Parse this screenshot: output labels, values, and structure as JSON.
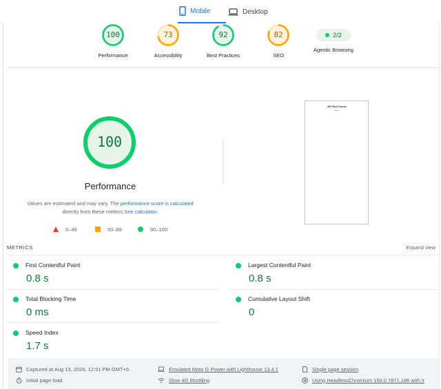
{
  "tabs": [
    {
      "label": "Mobile",
      "icon": "smartphone-icon",
      "active": true
    },
    {
      "label": "Desktop",
      "icon": "laptop-icon",
      "active": false
    }
  ],
  "colors": {
    "accent": "#1a73e8",
    "pass": "#0cce6b",
    "average": "#ffa400",
    "fail": "#e93c2f",
    "pass_text": "#0a7a3a",
    "average_text": "#b25e00"
  },
  "gauges": [
    {
      "score": "100",
      "value": 100,
      "label": "Performance",
      "status": "pass"
    },
    {
      "score": "73",
      "value": 73,
      "label": "Accessibility",
      "status": "average"
    },
    {
      "score": "92",
      "value": 92,
      "label": "Best Practices",
      "status": "pass"
    },
    {
      "score": "82",
      "value": 82,
      "label": "SEO",
      "status": "average"
    }
  ],
  "agentic": {
    "value": "2/2",
    "label": "Agentic Browsing"
  },
  "performance": {
    "score": "100",
    "value": 100,
    "title": "Performance",
    "note_prefix": "Values are estimated and may vary. The",
    "note_link": "performance score is calculated",
    "note_middle": "directly from these metrics.",
    "calc_link": "See calculator",
    "note_end": "."
  },
  "legend": [
    {
      "shape": "triangle",
      "range": "0–49"
    },
    {
      "shape": "square",
      "range": "50–89"
    },
    {
      "shape": "circle",
      "range": "90–100"
    }
  ],
  "thumbnail": {
    "title": "404 Not Found",
    "subtitle": "nginx"
  },
  "metrics": {
    "heading": "METRICS",
    "expand_label": "Expand view",
    "items": [
      {
        "name": "First Contentful Paint",
        "value": "0.8 s"
      },
      {
        "name": "Largest Contentful Paint",
        "value": "0.8 s"
      },
      {
        "name": "Total Blocking Time",
        "value": "0 ms"
      },
      {
        "name": "Cumulative Layout Shift",
        "value": "0"
      },
      {
        "name": "Speed Index",
        "value": "1.7 s"
      }
    ]
  },
  "footer": {
    "captured": "Captured at Aug 13, 2026, 12:51 PM GMT+6",
    "page_load": "Initial page load",
    "device": "Emulated Moto G Power with Lighthouse 13.4.1",
    "throttling": "Slow 4G throttling",
    "session": "Single page session",
    "browser": "Using HeadlessChromium 150.0.7871.186 with lr"
  }
}
